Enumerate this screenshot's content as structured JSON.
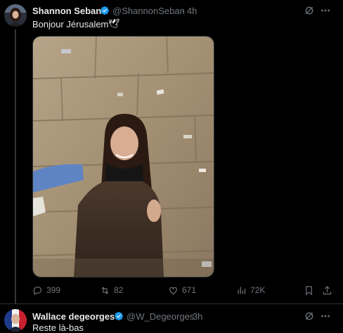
{
  "tweet": {
    "author_name": "Shannon Seban",
    "handle": "@ShannonSeban",
    "time": "· 4h",
    "text": "Bonjour Jérusalem",
    "emoji": "🕊",
    "stats": {
      "replies": "399",
      "reposts": "82",
      "likes": "671",
      "views": "72K"
    }
  },
  "reply": {
    "author_name": "Wallace degeorges",
    "handle": "@W_Degeorges",
    "time": "· 3h",
    "text": "Reste là-bas"
  },
  "icons": {
    "verified": "verified-badge-icon",
    "grok": "grok-icon",
    "more": "more-icon",
    "reply": "reply-icon",
    "repost": "repost-icon",
    "like": "like-icon",
    "views": "views-icon",
    "bookmark": "bookmark-icon",
    "share": "share-icon"
  },
  "colors": {
    "background": "#000000",
    "text": "#e7e9ea",
    "muted": "#71767b",
    "verified": "#1d9bf0"
  }
}
